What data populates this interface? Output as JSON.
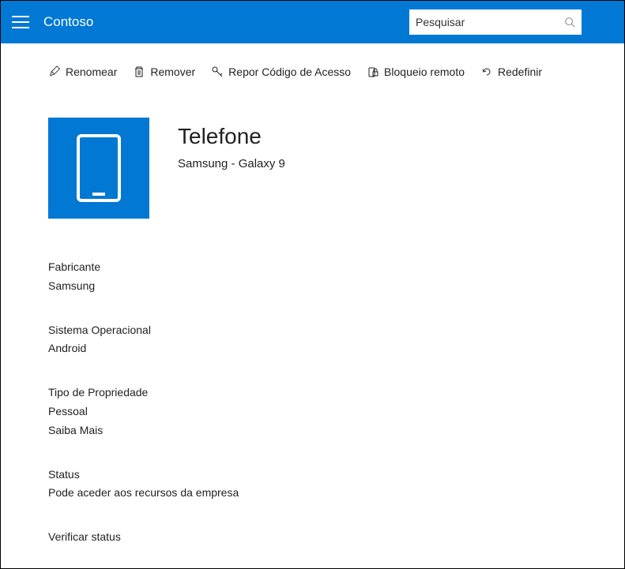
{
  "header": {
    "app_title": "Contoso",
    "search_placeholder": "Pesquisar"
  },
  "actions": {
    "rename": "Renomear",
    "remove": "Remover",
    "reset_passcode": "Repor Código de Acesso",
    "remote_lock": "Bloqueio remoto",
    "reset": "Redefinir"
  },
  "device": {
    "title": "Telefone",
    "model": "Samsung - Galaxy 9"
  },
  "details": {
    "manufacturer_label": "Fabricante",
    "manufacturer_value": "Samsung",
    "os_label": "Sistema Operacional",
    "os_value": "Android",
    "ownership_label": "Tipo de Propriedade",
    "ownership_value": "Pessoal",
    "learn_more": "Saiba Mais",
    "status_label": "Status",
    "status_value": "Pode aceder aos recursos da empresa",
    "check_status": "Verificar status"
  }
}
